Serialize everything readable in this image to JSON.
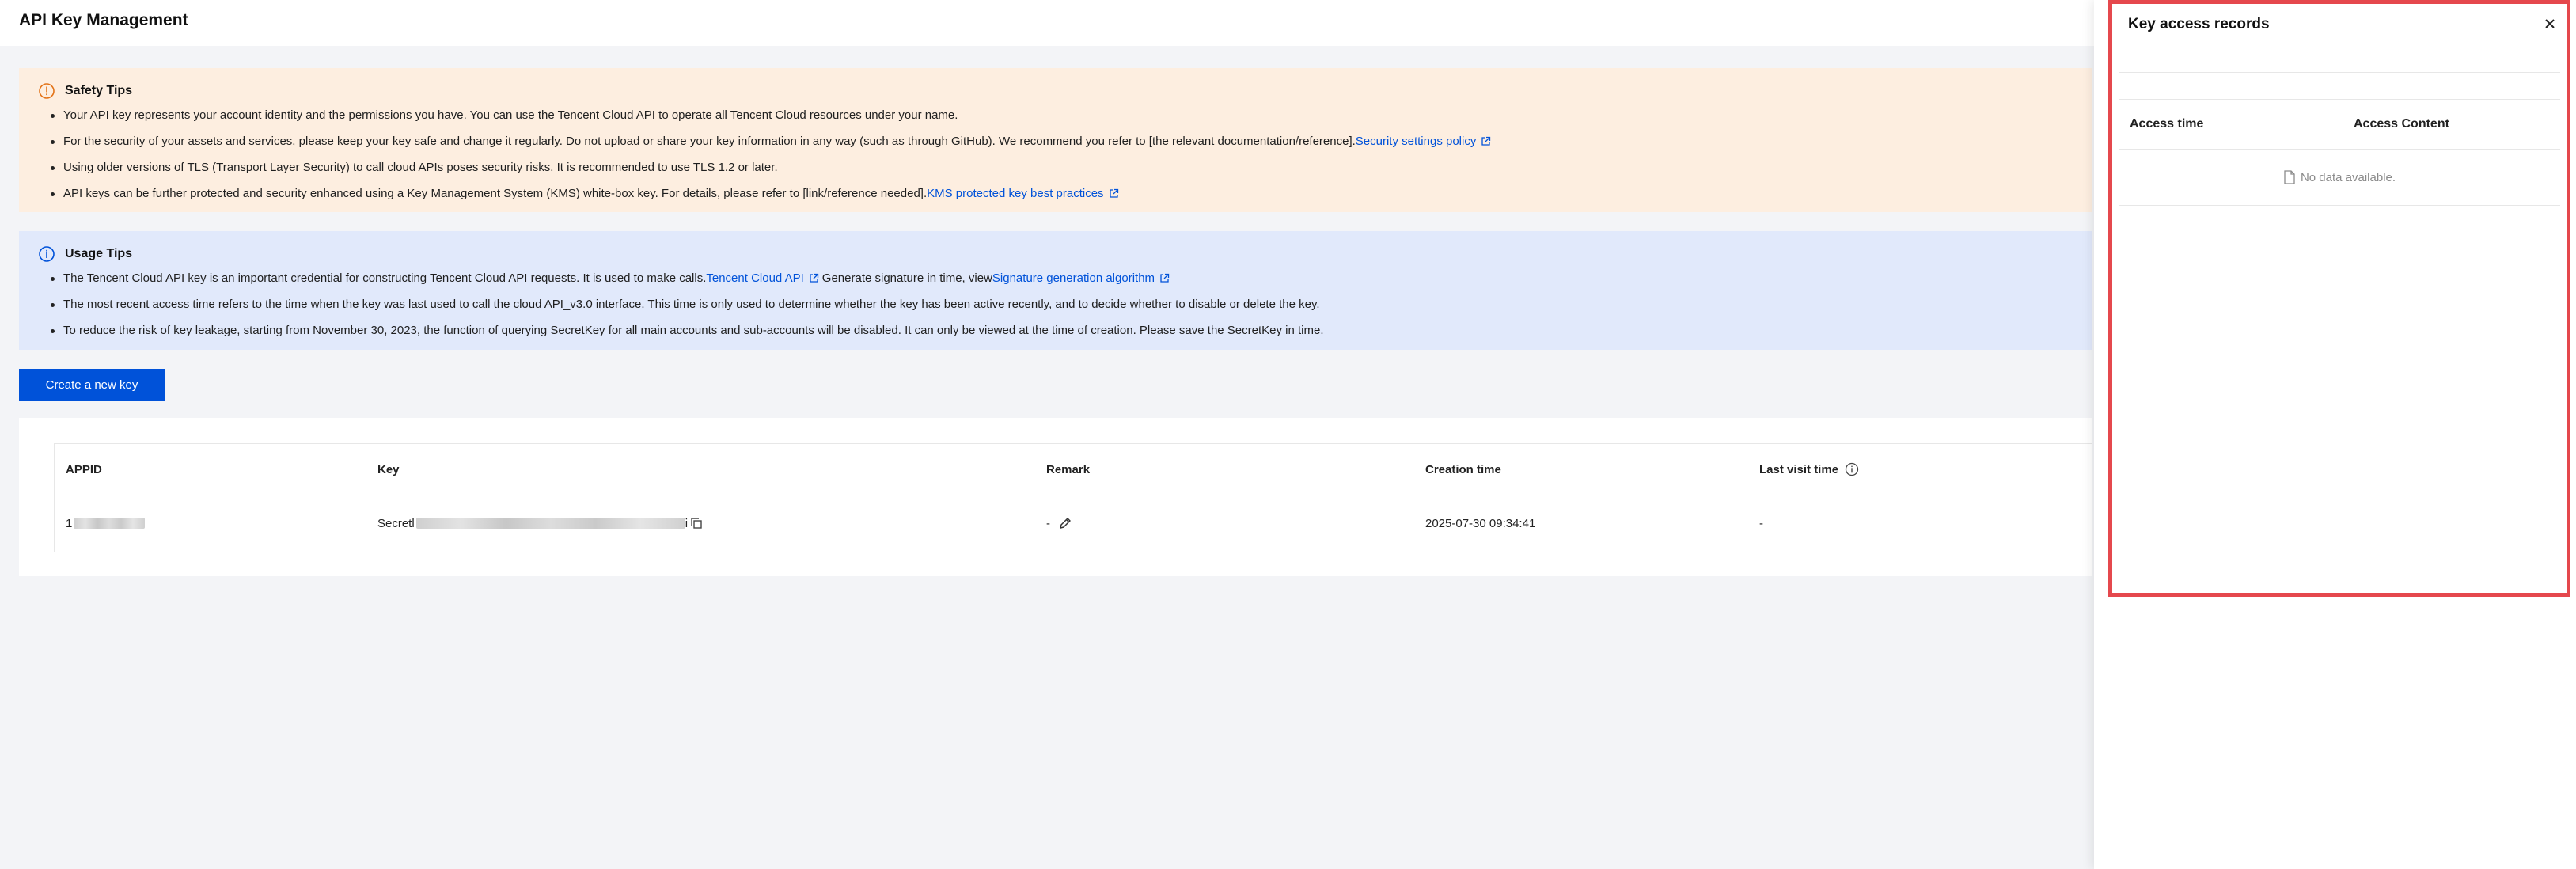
{
  "header": {
    "title": "API Key Management"
  },
  "safety_tips": {
    "title": "Safety Tips",
    "items": [
      {
        "text": "Your API key represents your account identity and the permissions you have. You can use the Tencent Cloud API to operate all Tencent Cloud resources under your name."
      },
      {
        "text": "For the security of your assets and services, please keep your key safe and change it regularly. Do not upload or share your key information in any way (such as through GitHub). We recommend you refer to [the relevant documentation/reference].",
        "link": "Security settings policy"
      },
      {
        "text": "Using older versions of TLS (Transport Layer Security) to call cloud APIs poses security risks. It is recommended to use TLS 1.2 or later."
      },
      {
        "text": "API keys can be further protected and security enhanced using a Key Management System (KMS) white-box key. For details, please refer to [link/reference needed].",
        "link": "KMS protected key best practices"
      }
    ]
  },
  "usage_tips": {
    "title": "Usage Tips",
    "item1": {
      "text_a": "The Tencent Cloud API key is an important credential for constructing Tencent Cloud API requests. It is used to make calls.",
      "link_a": "Tencent Cloud API",
      "text_b": "Generate signature in time, view",
      "link_b": "Signature generation algorithm"
    },
    "items": [
      {
        "text": "The most recent access time refers to the time when the key was last used to call the cloud API_v3.0 interface. This time is only used to determine whether the key has been active recently, and to decide whether to disable or delete the key."
      },
      {
        "text": "To reduce the risk of key leakage, starting from November 30, 2023, the function of querying SecretKey for all main accounts and sub-accounts will be disabled. It can only be viewed at the time of creation. Please save the SecretKey in time."
      }
    ]
  },
  "create_button": {
    "label": "Create a new key"
  },
  "key_table": {
    "columns": [
      "APPID",
      "Key",
      "Remark",
      "Creation time",
      "Last visit time"
    ],
    "rows": [
      {
        "appid_prefix": "1",
        "key_prefix": "Secretl",
        "key_suffix": "i",
        "remark": "-",
        "creation_time": "2025-07-30 09:34:41",
        "last_visit": "-"
      }
    ]
  },
  "drawer": {
    "title": "Key access records",
    "columns": [
      "Access time",
      "Access Content"
    ],
    "empty_text": "No data available."
  },
  "colors": {
    "accent": "#0052d9",
    "safety_bg": "#fdeee0",
    "usage_bg": "#e1e9fb",
    "highlight": "#e5484d"
  }
}
